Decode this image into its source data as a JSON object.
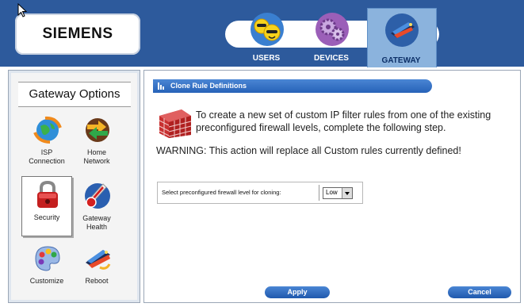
{
  "brand": {
    "name": "SIEMENS"
  },
  "nav": {
    "tabs": [
      {
        "label": "USERS",
        "icon": "users-smiley-icon"
      },
      {
        "label": "DEVICES",
        "icon": "devices-gears-icon"
      },
      {
        "label": "GATEWAY",
        "icon": "gateway-router-icon",
        "active": true
      }
    ]
  },
  "sidebar": {
    "title": "Gateway Options",
    "items": [
      {
        "label": "ISP\nConnection",
        "icon": "globe-arrows-icon"
      },
      {
        "label": "Home\nNetwork",
        "icon": "network-arrows-icon"
      },
      {
        "label": "Security",
        "icon": "padlock-icon",
        "selected": true
      },
      {
        "label": "Gateway\nHealth",
        "icon": "thermometer-icon"
      },
      {
        "label": "Customize",
        "icon": "palette-icon"
      },
      {
        "label": "Reboot",
        "icon": "reboot-icon"
      }
    ]
  },
  "main": {
    "section_title": "Clone Rule Definitions",
    "intro": "To create a new set of custom IP filter rules from one of the existing preconfigured firewall levels, complete the following step.",
    "warning": "WARNING: This action will replace all Custom rules currently defined!",
    "select_label": "Select preconfigured firewall level for cloning:",
    "select_value": "Low"
  },
  "buttons": {
    "apply": "Apply",
    "cancel": "Cancel"
  },
  "colors": {
    "topbar": "#2d5a9c",
    "accent": "#2762b8",
    "active_tab": "#8bb3dd"
  }
}
